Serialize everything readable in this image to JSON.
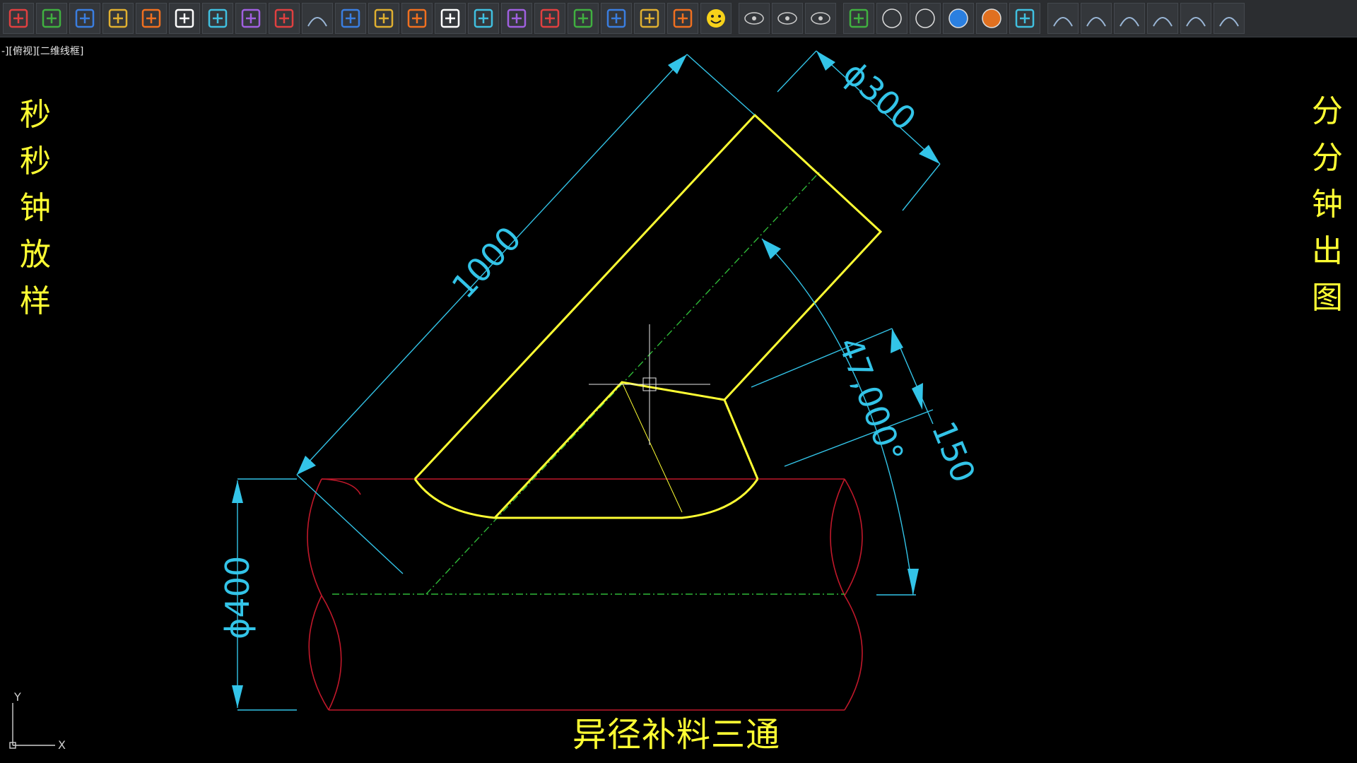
{
  "toolbar": {
    "buttons": [
      "settings-gear-icon",
      "block-frame-icon",
      "check-icon",
      "calendar-7-icon",
      "green-plus-icon",
      "numbered-circle-icon",
      "text-99-icon",
      "fan-blade-icon",
      "break-line-icon",
      "dimension-icon",
      "align-lines-icon",
      "eye-icon",
      "scissors-icon",
      "scale-arrows-icon",
      "list-check-icon",
      "zoom-in-icon",
      "edit-text-icon",
      "hand-pointer-icon",
      "calculator-icon",
      "refresh-red-icon",
      "checklist-icon",
      "smiley-icon",
      "orbit-icon",
      "orbit-free-icon",
      "orbit-continuous-icon",
      "box-select-icon",
      "sphere-wire-icon",
      "sphere-outline-icon",
      "sphere-blue-icon",
      "sphere-orange-icon",
      "globe-table-icon",
      "linear-dim-icon",
      "aligned-dim-icon",
      "arc-dim-icon",
      "ordinate-dim-icon",
      "arc-tool-icon",
      "multi-arc-icon"
    ]
  },
  "viewport": {
    "label": "-][俯视][二维线框]"
  },
  "titles": {
    "left": [
      "秒",
      "秒",
      "钟",
      "放",
      "样"
    ],
    "right": [
      "分",
      "分",
      "钟",
      "出",
      "图"
    ],
    "caption": "异径补料三通"
  },
  "dimensions": {
    "length": "1000",
    "branch_diameter": "ϕ300",
    "main_diameter": "ϕ400",
    "angle": "47,000°",
    "offset": "150"
  },
  "colors": {
    "background": "#000000",
    "outline": "#ffff33",
    "pipe": "#c0182a",
    "dimension": "#33c4e8",
    "centerline": "#2fb838",
    "title": "#ffff33"
  }
}
